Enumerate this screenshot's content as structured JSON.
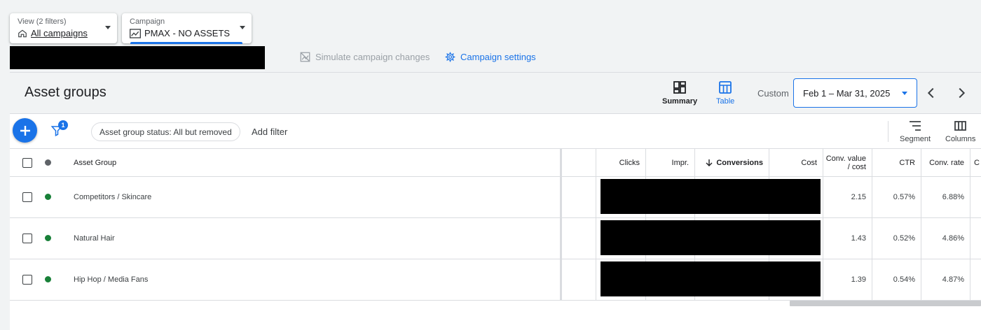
{
  "view_selector": {
    "label": "View (2 filters)",
    "value": "All campaigns"
  },
  "campaign_selector": {
    "label": "Campaign",
    "value": "PMAX - NO ASSETS"
  },
  "actions": {
    "simulate": "Simulate campaign changes",
    "settings": "Campaign settings"
  },
  "page_title": "Asset groups",
  "views": {
    "summary": "Summary",
    "table": "Table"
  },
  "date": {
    "custom_label": "Custom",
    "range": "Feb 1 – Mar 31, 2025"
  },
  "toolbar": {
    "filter_badge": "1",
    "status_chip": "Asset group status: All but removed",
    "add_filter": "Add filter",
    "segment": "Segment",
    "columns": "Columns"
  },
  "table": {
    "headers": {
      "asset_group": "Asset Group",
      "clicks": "Clicks",
      "impr": "Impr.",
      "conversions": "Conversions",
      "cost": "Cost",
      "conv_value_cost": "Conv. value / cost",
      "ctr": "CTR",
      "conv_rate": "Conv. rate",
      "next": "C"
    },
    "rows": [
      {
        "name": "Competitors / Skincare",
        "conv_value_cost": "2.15",
        "ctr": "0.57%",
        "conv_rate": "6.88%"
      },
      {
        "name": "Natural Hair",
        "conv_value_cost": "1.43",
        "ctr": "0.52%",
        "conv_rate": "4.86%"
      },
      {
        "name": "Hip Hop / Media Fans",
        "conv_value_cost": "1.39",
        "ctr": "0.54%",
        "conv_rate": "4.87%"
      }
    ],
    "status_color": "#188038"
  },
  "colors": {
    "accent": "#1a73e8",
    "status_enabled": "#188038"
  }
}
